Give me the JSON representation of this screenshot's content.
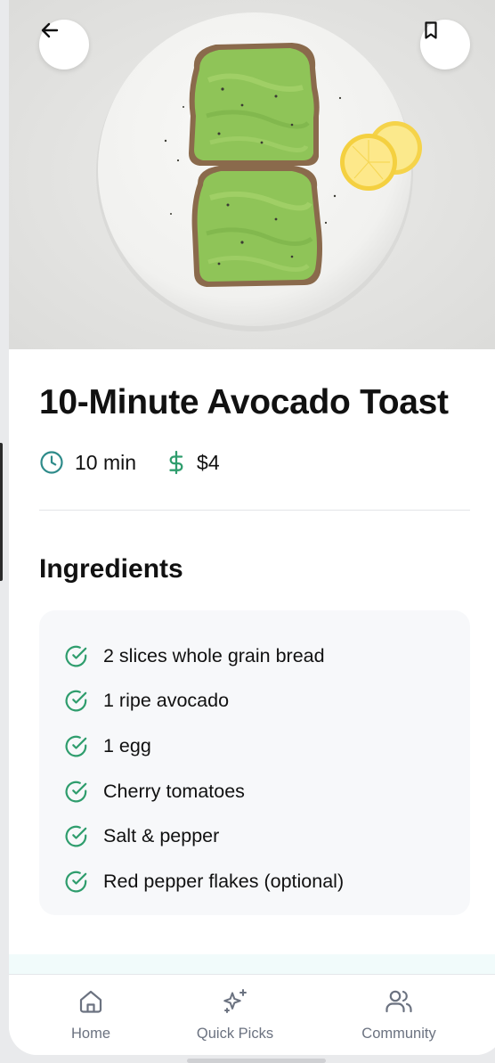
{
  "recipe": {
    "title": "10-Minute Avocado Toast",
    "time": "10 min",
    "cost": "$4"
  },
  "ingredients": {
    "heading": "Ingredients",
    "items": [
      "2 slices whole grain bread",
      "1 ripe avocado",
      "1 egg",
      "Cherry tomatoes",
      "Salt & pepper",
      "Red pepper flakes (optional)"
    ]
  },
  "nav": {
    "home": "Home",
    "quick_picks": "Quick Picks",
    "community": "Community"
  },
  "icons": {
    "back": "arrow-left-icon",
    "bookmark": "bookmark-icon",
    "time": "clock-icon",
    "cost": "dollar-icon",
    "check": "check-circle-icon",
    "home": "home-icon",
    "quick_picks": "sparkles-icon",
    "community": "users-icon"
  },
  "colors": {
    "accent_green": "#2f9d6d",
    "clock_teal": "#2e8b8a",
    "tab_gray": "#6b7280",
    "card_bg": "#f7f8fa"
  }
}
